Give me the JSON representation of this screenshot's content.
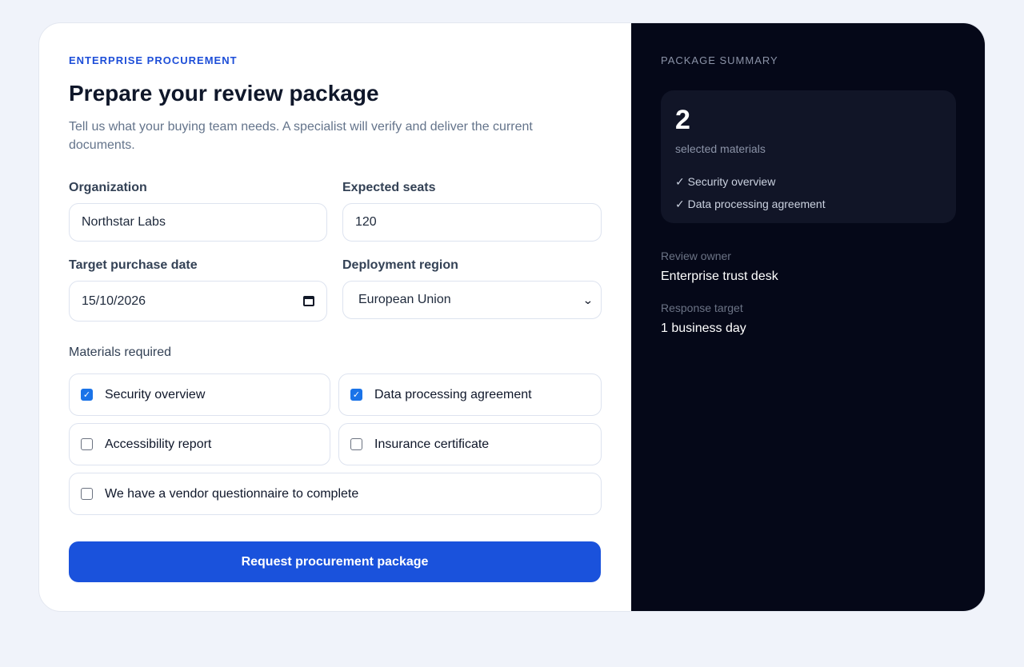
{
  "form": {
    "eyebrow": "ENTERPRISE PROCUREMENT",
    "title": "Prepare your review package",
    "subtitle": "Tell us what your buying team needs. A specialist will verify and deliver the current documents.",
    "organization": {
      "label": "Organization",
      "value": "Northstar Labs"
    },
    "seats": {
      "label": "Expected seats",
      "value": "120"
    },
    "date": {
      "label": "Target purchase date",
      "value": "15/10/2026"
    },
    "region": {
      "label": "Deployment region",
      "value": "European Union"
    },
    "materials_label": "Materials required",
    "materials": [
      {
        "label": "Security overview",
        "checked": true
      },
      {
        "label": "Data processing agreement",
        "checked": true
      },
      {
        "label": "Accessibility report",
        "checked": false
      },
      {
        "label": "Insurance certificate",
        "checked": false
      },
      {
        "label": "We have a vendor questionnaire to complete",
        "checked": false
      }
    ],
    "submit_label": "Request procurement package"
  },
  "summary": {
    "eyebrow": "PACKAGE SUMMARY",
    "count": "2",
    "count_label": "selected materials",
    "selected": [
      "✓ Security overview",
      "✓ Data processing agreement"
    ],
    "owner_label": "Review owner",
    "owner_value": "Enterprise trust desk",
    "target_label": "Response target",
    "target_value": "1 business day"
  },
  "colors": {
    "accent": "#1a52dc",
    "side_bg": "#050818",
    "page_bg": "#f0f3fa"
  }
}
